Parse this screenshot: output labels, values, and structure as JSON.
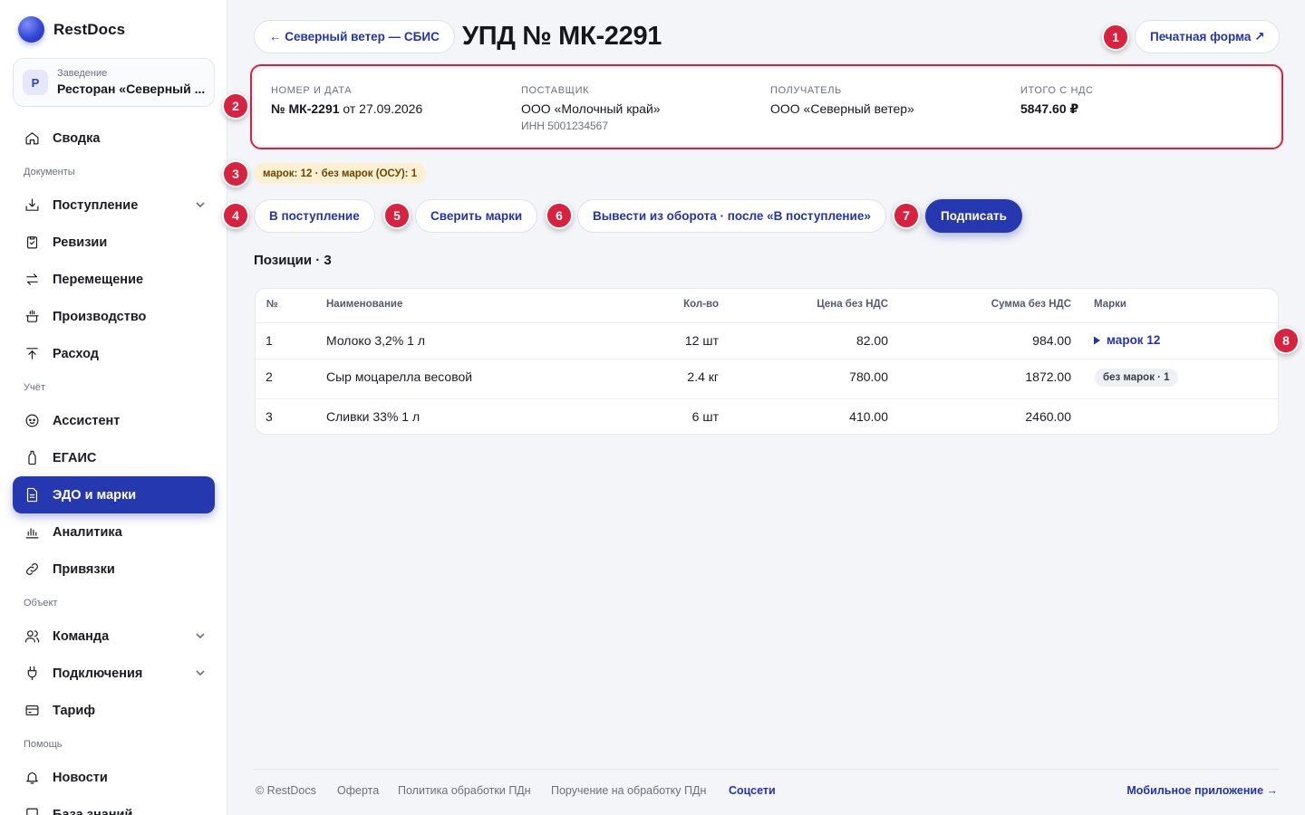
{
  "app": {
    "name": "RestDocs"
  },
  "venue": {
    "caption": "Заведение",
    "avatar_letter": "Р",
    "name": "Ресторан «Северный ..."
  },
  "nav": {
    "svodka": "Сводка",
    "section_documents": "Документы",
    "postuplenie": "Поступление",
    "revizii": "Ревизии",
    "peremeshchenie": "Перемещение",
    "proizvodstvo": "Производство",
    "raskhod": "Расход",
    "section_uchet": "Учёт",
    "assistant": "Ассистент",
    "egais": "ЕГАИС",
    "edo": "ЭДО и марки",
    "analitika": "Аналитика",
    "privyazki": "Привязки",
    "section_object": "Объект",
    "komanda": "Команда",
    "podklyucheniya": "Подключения",
    "tarif": "Тариф",
    "section_help": "Помощь",
    "novosti": "Новости",
    "baza": "База знаний"
  },
  "header": {
    "back_label": "← Северный ветер — СБИС",
    "title": "УПД № МК-2291",
    "print_label": "Печатная форма ↗"
  },
  "badges": [
    "1",
    "2",
    "3",
    "4",
    "5",
    "6",
    "7",
    "8"
  ],
  "info": {
    "number_caption": "Номер и дата",
    "number": "№ МК-2291",
    "date_text": " от 27.09.2026",
    "supplier_caption": "Поставщик",
    "supplier": "ООО «Молочный край»",
    "supplier_inn": "ИНН 5001234567",
    "recipient_caption": "Получатель",
    "recipient": "ООО «Северный ветер»",
    "total_caption": "Итого с НДС",
    "total": "5847.60 ₽"
  },
  "marks_summary": "марок: 12 · без марок (ОСУ): 1",
  "actions": {
    "receive": "В поступление",
    "verify": "Сверить марки",
    "withdraw": "Вывести из оборота · после «В поступление»",
    "sign": "Подписать"
  },
  "positions": {
    "title": "Позиции · 3",
    "columns": {
      "num": "№",
      "name": "Наименование",
      "qty": "Кол-во",
      "price": "Цена без НДС",
      "sum": "Сумма без НДС",
      "marks": "Марки"
    },
    "rows": [
      {
        "num": "1",
        "name": "Молоко 3,2% 1 л",
        "qty": "12 шт",
        "price": "82.00",
        "sum": "984.00",
        "marks": "марок 12"
      },
      {
        "num": "2",
        "name": "Сыр моцарелла весовой",
        "qty": "2.4 кг",
        "price": "780.00",
        "sum": "1872.00",
        "marks": "без марок · 1"
      },
      {
        "num": "3",
        "name": "Сливки 33% 1 л",
        "qty": "6 шт",
        "price": "410.00",
        "sum": "2460.00",
        "marks": ""
      }
    ]
  },
  "footer": {
    "copyright": "© RestDocs",
    "offer": "Оферта",
    "privacy": "Политика обработки ПДн",
    "assignment": "Поручение на обработку ПДн",
    "social": "Соцсети",
    "mobile": "Мобильное приложение →"
  },
  "colors": {
    "accent": "#2638b0",
    "annotation": "#d8223f",
    "marks_pill_bg": "#fbf0d2"
  },
  "icons": [
    "home-icon",
    "inbox-icon",
    "clipboard-check-icon",
    "arrows-swap-icon",
    "pot-icon",
    "arrow-up-icon",
    "assistant-icon",
    "bottle-icon",
    "document-icon",
    "bar-chart-icon",
    "link-icon",
    "users-icon",
    "plug-icon",
    "card-icon",
    "bell-icon",
    "book-icon",
    "chevron-down-icon",
    "play-triangle-icon"
  ]
}
